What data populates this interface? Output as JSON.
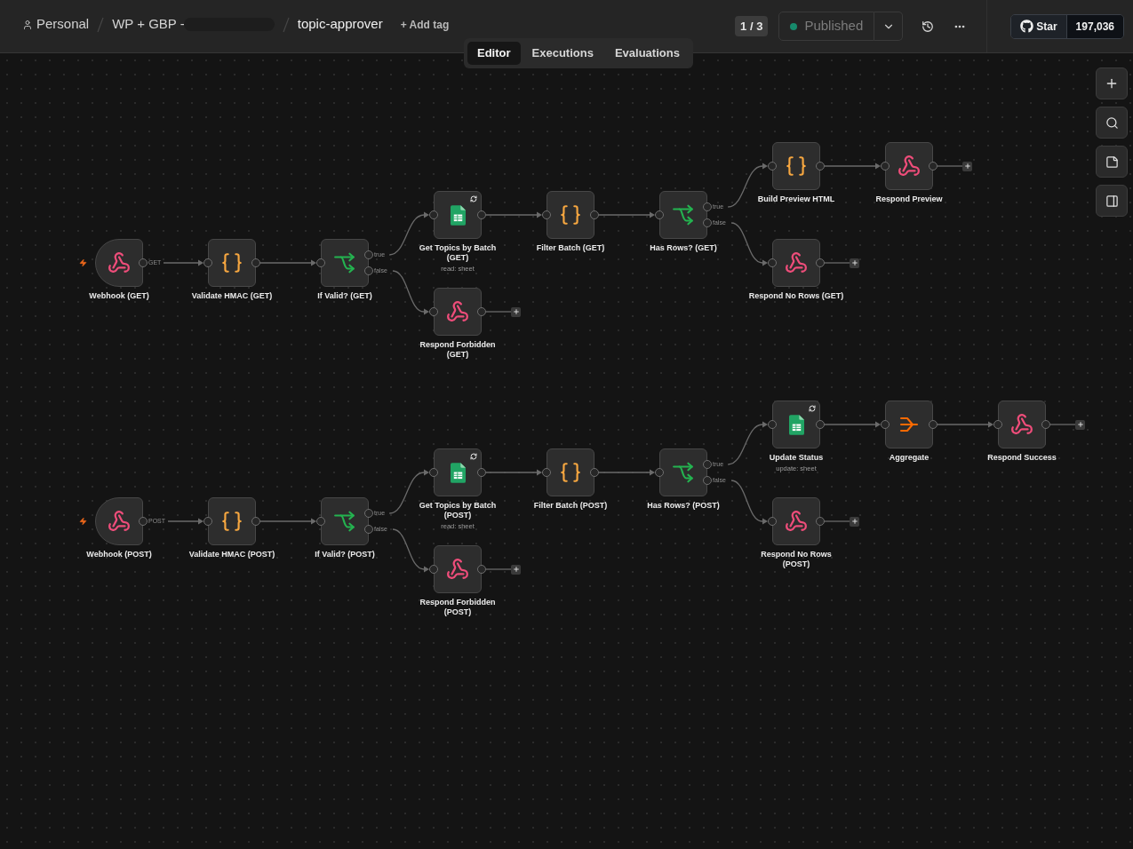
{
  "breadcrumb": {
    "owner": "Personal",
    "folder": "WP + GBP -",
    "workflow": "topic-approver",
    "add_tag": "+ Add tag"
  },
  "version": "1 / 3",
  "publish": {
    "label": "Published",
    "published": true
  },
  "github": {
    "label": "Star",
    "count": "197,036"
  },
  "tabs": [
    {
      "label": "Editor",
      "selected": true
    },
    {
      "label": "Executions",
      "selected": false
    },
    {
      "label": "Evaluations",
      "selected": false
    }
  ],
  "nodes": [
    {
      "name": "Webhook (GET)",
      "kind": "trigger",
      "outputs": [
        "GET"
      ]
    },
    {
      "name": "Validate HMAC (GET)",
      "kind": "code"
    },
    {
      "name": "If Valid? (GET)",
      "kind": "if",
      "outputs": [
        "true",
        "false"
      ]
    },
    {
      "name": "Get Topics by Batch (GET)",
      "kind": "sheets",
      "subtitle": "read: sheet"
    },
    {
      "name": "Respond Forbidden (GET)",
      "kind": "respond"
    },
    {
      "name": "Filter Batch (GET)",
      "kind": "code"
    },
    {
      "name": "Has Rows? (GET)",
      "kind": "if",
      "outputs": [
        "true",
        "false"
      ]
    },
    {
      "name": "Build Preview HTML",
      "kind": "code"
    },
    {
      "name": "Respond Preview",
      "kind": "respond"
    },
    {
      "name": "Respond No Rows (GET)",
      "kind": "respond"
    },
    {
      "name": "Webhook (POST)",
      "kind": "trigger",
      "outputs": [
        "POST"
      ]
    },
    {
      "name": "Validate HMAC (POST)",
      "kind": "code"
    },
    {
      "name": "If Valid? (POST)",
      "kind": "if",
      "outputs": [
        "true",
        "false"
      ]
    },
    {
      "name": "Get Topics by Batch (POST)",
      "kind": "sheets",
      "subtitle": "read: sheet"
    },
    {
      "name": "Respond Forbidden (POST)",
      "kind": "respond"
    },
    {
      "name": "Filter Batch (POST)",
      "kind": "code"
    },
    {
      "name": "Has Rows? (POST)",
      "kind": "if",
      "outputs": [
        "true",
        "false"
      ]
    },
    {
      "name": "Update Status",
      "kind": "sheets",
      "subtitle": "update: sheet"
    },
    {
      "name": "Aggregate",
      "kind": "aggregate"
    },
    {
      "name": "Respond Success",
      "kind": "respond"
    },
    {
      "name": "Respond No Rows (POST)",
      "kind": "respond"
    }
  ]
}
